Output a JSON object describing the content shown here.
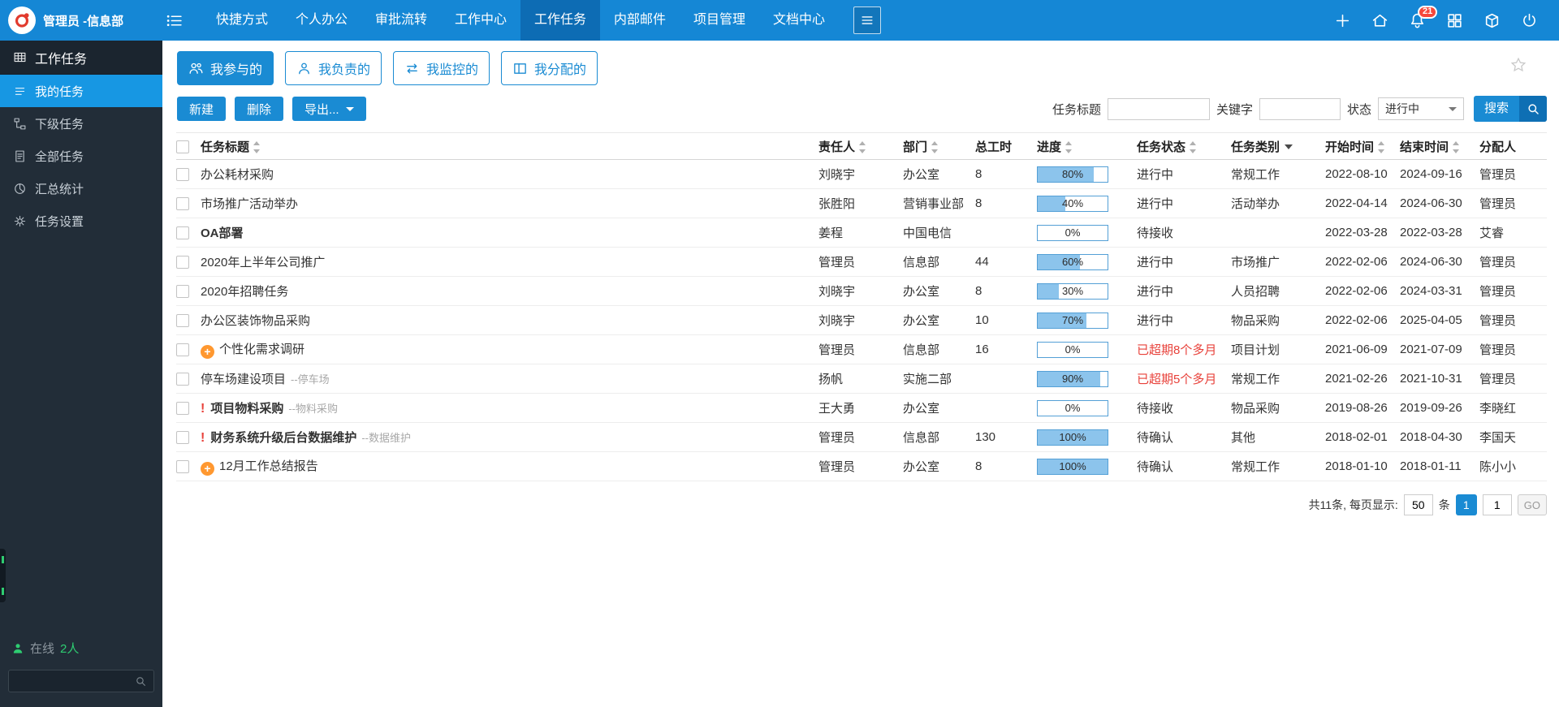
{
  "colors": {
    "topbar_blue": "#1587d5",
    "accent_blue": "#1a8bd3",
    "active_menu_blue": "#0d6cb4",
    "sidebar_bg": "#222d38",
    "sidebar_active_blue": "#1797e3",
    "overdue_red": "#e8413a",
    "progress_fill": "#8cc4ec",
    "progress_border": "#54a0d6",
    "online_green": "#2ecc71",
    "flag_orange": "#ff9830"
  },
  "topbar": {
    "user": "管理员 -信息部",
    "menu": [
      {
        "label": "快捷方式"
      },
      {
        "label": "个人办公"
      },
      {
        "label": "审批流转"
      },
      {
        "label": "工作中心"
      },
      {
        "label": "工作任务",
        "active": true
      },
      {
        "label": "内部邮件"
      },
      {
        "label": "项目管理"
      },
      {
        "label": "文档中心"
      }
    ],
    "notification_badge": "21",
    "right_icons": [
      "plus-icon",
      "home-icon",
      "notifications-bell-icon",
      "apps-grid-icon",
      "package-icon",
      "power-icon"
    ]
  },
  "sidebar": {
    "header": {
      "label": "工作任务",
      "icon": "tbl"
    },
    "items": [
      {
        "label": "我的任务",
        "icon": "list",
        "active": true
      },
      {
        "label": "下级任务",
        "icon": "level"
      },
      {
        "label": "全部任务",
        "icon": "doc"
      },
      {
        "label": "汇总统计",
        "icon": "pie"
      },
      {
        "label": "任务设置",
        "icon": "gear"
      }
    ],
    "online_label": "在线",
    "online_count": "2人",
    "search_value": ""
  },
  "tabs": [
    {
      "label": "我参与的",
      "icon": "people",
      "active": true
    },
    {
      "label": "我负责的",
      "icon": "person"
    },
    {
      "label": "我监控的",
      "icon": "swap"
    },
    {
      "label": "我分配的",
      "icon": "cols"
    }
  ],
  "toolbar": {
    "new_label": "新建",
    "delete_label": "删除",
    "export_label": "导出...",
    "title_filter_label": "任务标题",
    "title_filter_value": "",
    "keyword_label": "关键字",
    "keyword_value": "",
    "status_label": "状态",
    "status_value": "进行中",
    "search_label": "搜索"
  },
  "table": {
    "headers": [
      {
        "label": "任务标题",
        "sort": "arrows"
      },
      {
        "label": "责任人",
        "sort": "arrows"
      },
      {
        "label": "部门",
        "sort": "arrows"
      },
      {
        "label": "总工时",
        "sort": "none"
      },
      {
        "label": "进度",
        "sort": "arrows"
      },
      {
        "label": "任务状态",
        "sort": "arrows"
      },
      {
        "label": "任务类别",
        "sort": "caret"
      },
      {
        "label": "开始时间",
        "sort": "arrows"
      },
      {
        "label": "结束时间",
        "sort": "arrows"
      },
      {
        "label": "分配人",
        "sort": "none"
      }
    ],
    "rows": [
      {
        "title": "办公耗材采购",
        "owner": "刘晓宇",
        "dept": "办公室",
        "hours": "8",
        "progress": "80%",
        "status": "进行中",
        "category": "常规工作",
        "start": "2022-08-10",
        "end": "2024-09-16",
        "assigner": "管理员"
      },
      {
        "title": "市场推广活动举办",
        "owner": "张胜阳",
        "dept": "营销事业部",
        "hours": "8",
        "progress": "40%",
        "status": "进行中",
        "category": "活动举办",
        "start": "2022-04-14",
        "end": "2024-06-30",
        "assigner": "管理员"
      },
      {
        "title": "OA部署",
        "bold": true,
        "owner": "姜程",
        "dept": "中国电信",
        "hours": "",
        "progress": "0%",
        "status": "待接收",
        "category": "",
        "start": "2022-03-28",
        "end": "2022-03-28",
        "assigner": "艾睿"
      },
      {
        "title": "2020年上半年公司推广",
        "owner": "管理员",
        "dept": "信息部",
        "hours": "44",
        "progress": "60%",
        "status": "进行中",
        "category": "市场推广",
        "start": "2022-02-06",
        "end": "2024-06-30",
        "assigner": "管理员"
      },
      {
        "title": "2020年招聘任务",
        "owner": "刘晓宇",
        "dept": "办公室",
        "hours": "8",
        "progress": "30%",
        "status": "进行中",
        "category": "人员招聘",
        "start": "2022-02-06",
        "end": "2024-03-31",
        "assigner": "管理员"
      },
      {
        "title": "办公区装饰物品采购",
        "owner": "刘晓宇",
        "dept": "办公室",
        "hours": "10",
        "progress": "70%",
        "status": "进行中",
        "category": "物品采购",
        "start": "2022-02-06",
        "end": "2025-04-05",
        "assigner": "管理员"
      },
      {
        "flag": "plus",
        "title": "个性化需求调研",
        "owner": "管理员",
        "dept": "信息部",
        "hours": "16",
        "progress": "0%",
        "status": "已超期8个多月",
        "red": true,
        "category": "项目计划",
        "start": "2021-06-09",
        "end": "2021-07-09",
        "assigner": "管理员"
      },
      {
        "title": "停车场建设项目",
        "subtitle": "--停车场",
        "owner": "扬帆",
        "dept": "实施二部",
        "hours": "",
        "progress": "90%",
        "status": "已超期5个多月",
        "red": true,
        "category": "常规工作",
        "start": "2021-02-26",
        "end": "2021-10-31",
        "assigner": "管理员"
      },
      {
        "flag": "exclaim",
        "title": "项目物料采购",
        "bold": true,
        "subtitle": "--物料采购",
        "owner": "王大勇",
        "dept": "办公室",
        "hours": "",
        "progress": "0%",
        "status": "待接收",
        "category": "物品采购",
        "start": "2019-08-26",
        "end": "2019-09-26",
        "assigner": "李晓红"
      },
      {
        "flag": "exclaim",
        "title": "财务系统升级后台数据维护",
        "bold": true,
        "subtitle": "--数据维护",
        "owner": "管理员",
        "dept": "信息部",
        "hours": "130",
        "progress": "100%",
        "status": "待确认",
        "category": "其他",
        "start": "2018-02-01",
        "end": "2018-04-30",
        "assigner": "李国天"
      },
      {
        "flag": "plus",
        "title": "12月工作总结报告",
        "owner": "管理员",
        "dept": "办公室",
        "hours": "8",
        "progress": "100%",
        "status": "待确认",
        "category": "常规工作",
        "start": "2018-01-10",
        "end": "2018-01-11",
        "assigner": "陈小小"
      }
    ]
  },
  "pagination": {
    "summary": "共11条, 每页显示:",
    "page_size": "50",
    "unit_label": "条",
    "current_page": "1",
    "page_input": "1",
    "go_label": "GO"
  }
}
